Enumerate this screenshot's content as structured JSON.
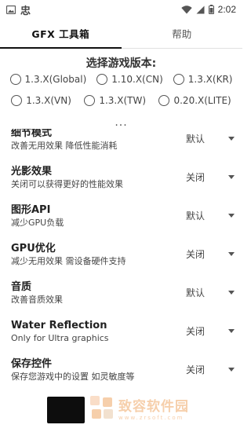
{
  "status_bar": {
    "app_glyph": "忠",
    "time": "2:02"
  },
  "tabs": [
    {
      "label": "GFX 工具箱",
      "active": true
    },
    {
      "label": "帮助",
      "active": false
    }
  ],
  "version_selector": {
    "title": "选择游戏版本:",
    "row1": [
      "1.3.X(Global)",
      "1.10.X(CN)",
      "1.3.X(KR)"
    ],
    "row2": [
      "1.3.X(VN)",
      "1.3.X(TW)",
      "0.20.X(LITE)"
    ],
    "more": "..."
  },
  "settings": [
    {
      "title": "细节模式",
      "desc": "改善无用效果 降低性能消耗",
      "value": "默认"
    },
    {
      "title": "光影效果",
      "desc": "关闭可以获得更好的性能效果",
      "value": "关闭"
    },
    {
      "title": "图形API",
      "desc": "减少GPU负载",
      "value": "默认"
    },
    {
      "title": "GPU优化",
      "desc": "减少无用效果 需设备硬件支持",
      "value": "关闭"
    },
    {
      "title": "音质",
      "desc": "改善音质效果",
      "value": "默认"
    },
    {
      "title": "Water Reflection",
      "desc": "Only for Ultra graphics",
      "value": "关闭"
    },
    {
      "title": "保存控件",
      "desc": "保存您游戏中的设置 如灵敏度等",
      "value": "关闭"
    }
  ],
  "watermark": {
    "main": "致容软件园",
    "sub": "www.zrsoft.com"
  },
  "colors": {
    "accent": "#111111",
    "watermark": "#f0a868"
  }
}
